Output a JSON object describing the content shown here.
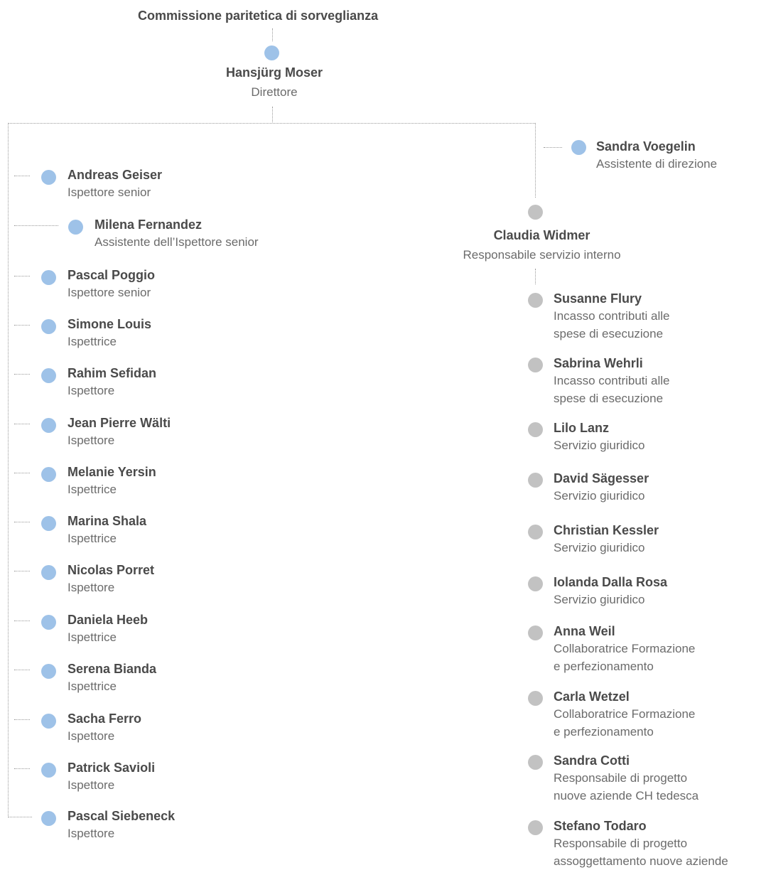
{
  "header": {
    "title": "Commissione paritetica di sorveglianza",
    "director_name": "Hansjürg Moser",
    "director_role": "Direttore"
  },
  "assistant": {
    "name": "Sandra Voegelin",
    "role": "Assistente di direzione"
  },
  "internal_head": {
    "name": "Claudia Widmer",
    "role": "Responsabile servizio interno"
  },
  "inspectors": [
    {
      "name": "Andreas Geiser",
      "role": "Ispettore senior"
    },
    {
      "name": "Milena Fernandez",
      "role": "Assistente dell’Ispettore senior"
    },
    {
      "name": "Pascal Poggio",
      "role": "Ispettore senior"
    },
    {
      "name": "Simone Louis",
      "role": "Ispettrice"
    },
    {
      "name": "Rahim Sefidan",
      "role": "Ispettore"
    },
    {
      "name": "Jean Pierre Wälti",
      "role": "Ispettore"
    },
    {
      "name": "Melanie Yersin",
      "role": "Ispettrice"
    },
    {
      "name": "Marina Shala",
      "role": "Ispettrice"
    },
    {
      "name": "Nicolas Porret",
      "role": "Ispettore"
    },
    {
      "name": "Daniela Heeb",
      "role": "Ispettrice"
    },
    {
      "name": "Serena Bianda",
      "role": "Ispettrice"
    },
    {
      "name": "Sacha Ferro",
      "role": "Ispettore"
    },
    {
      "name": "Patrick Savioli",
      "role": "Ispettore"
    },
    {
      "name": "Pascal Siebeneck",
      "role": "Ispettore"
    }
  ],
  "staff": [
    {
      "name": "Susanne Flury",
      "role": "Incasso contributi alle\nspese di esecuzione"
    },
    {
      "name": "Sabrina Wehrli",
      "role": "Incasso contributi alle\nspese di esecuzione"
    },
    {
      "name": "Lilo Lanz",
      "role": "Servizio giuridico"
    },
    {
      "name": "David Sägesser",
      "role": "Servizio giuridico"
    },
    {
      "name": "Christian Kessler",
      "role": "Servizio giuridico"
    },
    {
      "name": "Iolanda Dalla Rosa",
      "role": "Servizio giuridico"
    },
    {
      "name": "Anna Weil",
      "role": "Collaboratrice Formazione\ne perfezionamento"
    },
    {
      "name": "Carla Wetzel",
      "role": "Collaboratrice Formazione\ne perfezionamento"
    },
    {
      "name": "Sandra Cotti",
      "role": "Responsabile di progetto\nnuove aziende CH tedesca"
    },
    {
      "name": "Stefano Todaro",
      "role": "Responsabile di progetto\nassoggettamento nuove aziende"
    }
  ],
  "colors": {
    "inspector_dot": "#9ec2e8",
    "staff_dot": "#c2c2c2"
  }
}
